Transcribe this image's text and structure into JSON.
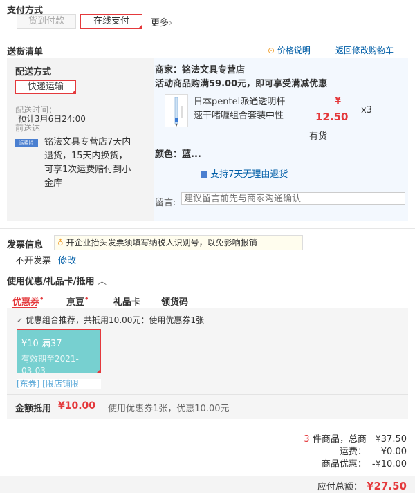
{
  "payment": {
    "title": "支付方式",
    "option_cod": "货到付款",
    "option_online": "在线支付",
    "more": "更多",
    "more_arrow": "›"
  },
  "shipping_list": {
    "title": "送货清单",
    "price_note": "价格说明",
    "back_to_cart": "返回修改购物车",
    "method_title": "配送方式",
    "method_value": "快递运输",
    "time_label": "配送时间：",
    "time_value": "预计3月6日24:00",
    "time_suffix": "前送达",
    "service_badge": "运费险",
    "service_text": "铭法文具专营店7天内退货，15天内换货，可享1次运费赔付到小金库",
    "merchant": "商家：铭法文具专营店",
    "promo": "活动商品购满59.00元，即可享受满减优惠",
    "product_name": "日本pentel派通透明杆速干啫喱组合套装中性",
    "product_price_symbol": "¥",
    "product_price": "12.50",
    "product_qty": "x3",
    "stock": "有货",
    "color_label": "颜色：蓝...",
    "return_policy": "支持7天无理由退货",
    "remark_label": "留言:",
    "remark_placeholder": "建议留言前先与商家沟通确认"
  },
  "invoice": {
    "title": "发票信息",
    "tip": "开企业抬头发票须填写纳税人识别号，以免影响报销",
    "value": "不开发票",
    "edit": "修改"
  },
  "discount": {
    "title": "使用优惠/礼品卡/抵用",
    "tabs": [
      "优惠券",
      "京豆",
      "礼品卡",
      "领货码"
    ],
    "tab_dots": [
      "•",
      "•"
    ],
    "recommend": "优惠组合推荐，共抵用10.00元：使用优惠券1张",
    "coupon_amount": "¥10 满37",
    "coupon_validity": "有效期至2021-",
    "coupon_validity2": "03-03",
    "coupon_tags": "[东券] [限店铺限",
    "deduct_label": "金额抵用",
    "deduct_value": "¥10.00",
    "deduct_desc": "使用优惠券1张，优惠10.00元"
  },
  "totals": {
    "count": "3",
    "count_label": "件商品，总商",
    "goods_total": "¥37.50",
    "freight_label": "运费：",
    "freight_value": "¥0.00",
    "discount_label": "商品优惠：",
    "discount_value": "-¥10.00",
    "payable_label": "应付总额：",
    "payable_value": "¥27.50"
  },
  "colors": {
    "accent_red": "#e4393c",
    "link_blue": "#005ea7",
    "coupon_teal": "#77d0d0"
  }
}
